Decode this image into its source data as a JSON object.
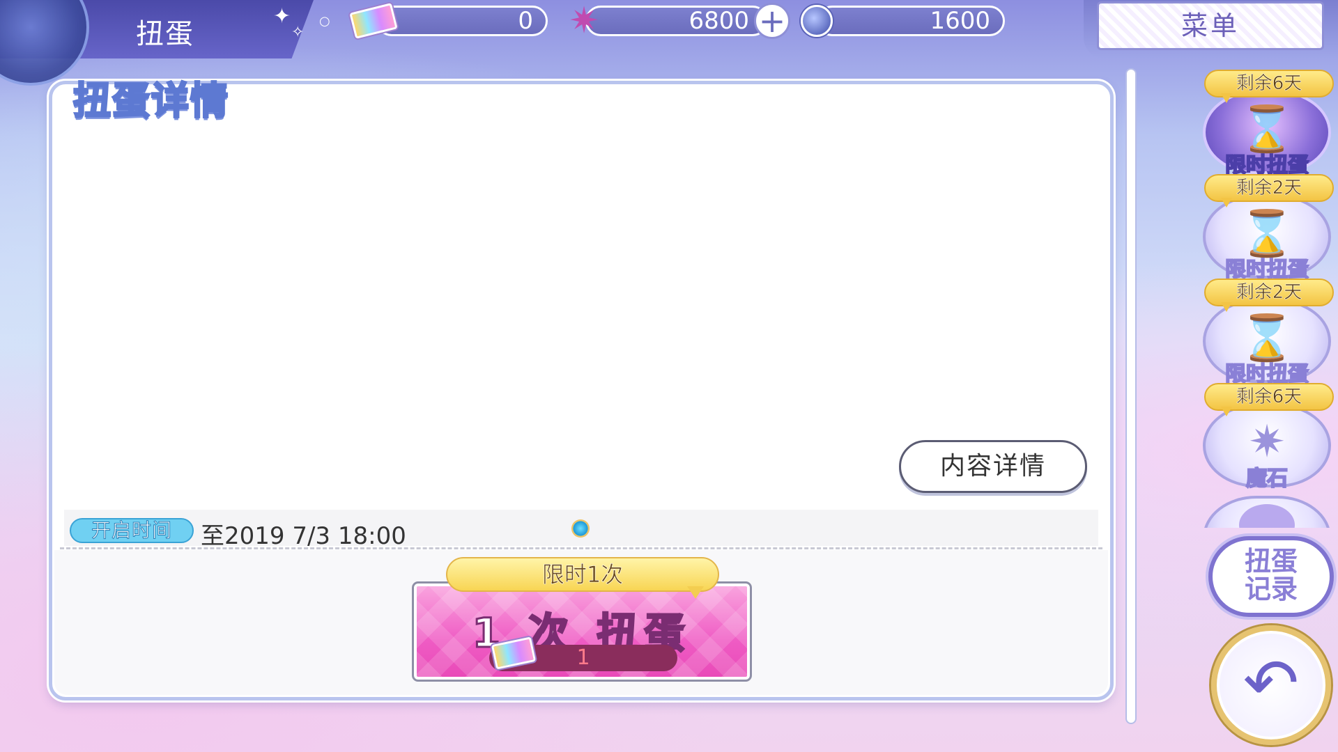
{
  "header": {
    "title": "扭蛋",
    "menu_label": "菜单",
    "plus_label": "+"
  },
  "currencies": [
    {
      "name": "gacha-ticket",
      "value": "0",
      "icon": "ticket-icon"
    },
    {
      "name": "star-stone",
      "value": "6800",
      "icon": "magic-star-icon"
    },
    {
      "name": "potion",
      "value": "1600",
      "icon": "potion-icon"
    }
  ],
  "panel": {
    "title": "扭蛋详情",
    "detail_button": "内容详情",
    "open_time_badge": "开启时间",
    "open_time_value": "至2019 7/3 18:00",
    "limit_label": "限时1次",
    "pull_button": "1 次 扭蛋",
    "pull_cost": "1"
  },
  "side_banners": [
    {
      "days": "剩余6天",
      "label": "限时扭蛋",
      "active": true,
      "icon": "hourglass-clock-icon"
    },
    {
      "days": "剩余2天",
      "label": "限时扭蛋",
      "active": false,
      "icon": "hourglass-clock-icon"
    },
    {
      "days": "剩余2天",
      "label": "限时扭蛋",
      "active": false,
      "icon": "hourglass-clock-icon"
    },
    {
      "days": "剩余6天",
      "label": "魔石",
      "active": false,
      "icon": "magic-star-icon"
    }
  ],
  "record_button": [
    "扭蛋",
    "记录"
  ],
  "back_icon": "back-arrow-icon",
  "colors": {
    "accent": "#6b6dbd",
    "pull_button": "#ef5cc4",
    "badge": "#70d0f2",
    "days_badge": "#f3c444"
  }
}
